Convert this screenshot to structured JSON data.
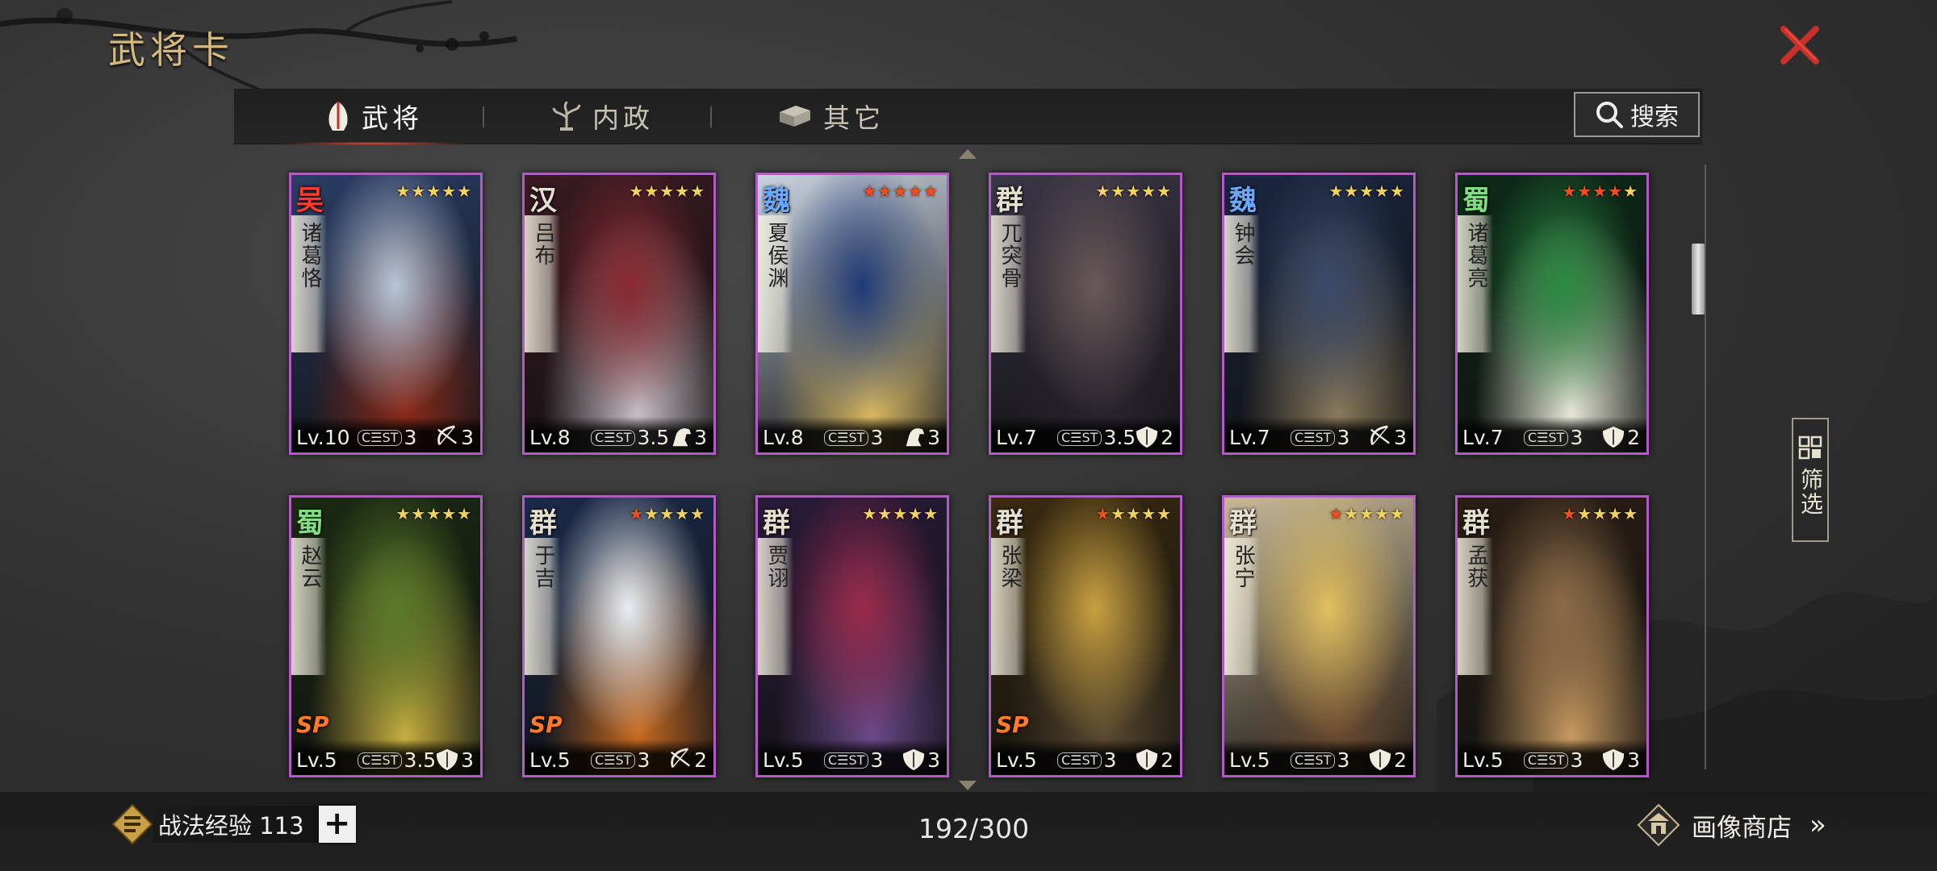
{
  "header": {
    "title": "武将卡"
  },
  "tabs": [
    {
      "label": "武将",
      "icon": "helmet-icon",
      "active": true
    },
    {
      "label": "内政",
      "icon": "tree-icon",
      "active": false
    },
    {
      "label": "其它",
      "icon": "chest-icon",
      "active": false
    }
  ],
  "search": {
    "label": "搜索"
  },
  "filter": {
    "label": "筛选"
  },
  "cards": [
    {
      "faction": "吴",
      "faction_color": "#ff3b2f",
      "name": "诸葛恪",
      "stars_red": 0,
      "level": "Lv.10",
      "cost": "3",
      "troop_icon": "bow-icon",
      "troop_count": "3",
      "sp": false,
      "art": [
        "#2a3d66",
        "#b8c6d8",
        "#8c2a1a"
      ]
    },
    {
      "faction": "汉",
      "faction_color": "#e6e0d0",
      "name": "吕布",
      "stars_red": 0,
      "level": "Lv.8",
      "cost": "3.5",
      "troop_icon": "horse-icon",
      "troop_count": "3",
      "sp": false,
      "art": [
        "#3a1a22",
        "#8a2a30",
        "#c8c0c8"
      ]
    },
    {
      "faction": "魏",
      "faction_color": "#6aa8ff",
      "name": "夏侯渊",
      "stars_red": 5,
      "level": "Lv.8",
      "cost": "3",
      "troop_icon": "horse-icon",
      "troop_count": "3",
      "sp": false,
      "art": [
        "#c8d2e0",
        "#1e3a78",
        "#d8b860"
      ]
    },
    {
      "faction": "群",
      "faction_color": "#e6e0d0",
      "name": "兀突骨",
      "stars_red": 0,
      "level": "Lv.7",
      "cost": "3.5",
      "troop_icon": "shield-icon",
      "troop_count": "2",
      "sp": false,
      "art": [
        "#3c3648",
        "#6a5a5a",
        "#2a2430"
      ]
    },
    {
      "faction": "魏",
      "faction_color": "#6aa8ff",
      "name": "钟会",
      "stars_red": 0,
      "level": "Lv.7",
      "cost": "3",
      "troop_icon": "bow-icon",
      "troop_count": "3",
      "sp": false,
      "art": [
        "#1a2640",
        "#3a4a6a",
        "#8a7a5a"
      ]
    },
    {
      "faction": "蜀",
      "faction_color": "#7ee07e",
      "name": "诸葛亮",
      "stars_red": 4,
      "level": "Lv.7",
      "cost": "3",
      "troop_icon": "shield-icon",
      "troop_count": "2",
      "sp": false,
      "art": [
        "#0c2a18",
        "#2a8a40",
        "#e8e8d8"
      ]
    },
    {
      "faction": "蜀",
      "faction_color": "#7ee07e",
      "name": "赵云",
      "stars_red": 0,
      "level": "Lv.5",
      "cost": "3.5",
      "troop_icon": "shield-icon",
      "troop_count": "3",
      "sp": true,
      "art": [
        "#1a2a12",
        "#5a7a2a",
        "#c8b040"
      ]
    },
    {
      "faction": "群",
      "faction_color": "#e6e0d0",
      "name": "于吉",
      "stars_red": 1,
      "level": "Lv.5",
      "cost": "3",
      "troop_icon": "bow-icon",
      "troop_count": "2",
      "sp": true,
      "art": [
        "#1a2a4a",
        "#e8eef4",
        "#c86a20"
      ]
    },
    {
      "faction": "群",
      "faction_color": "#e6e0d0",
      "name": "贾诩",
      "stars_red": 0,
      "level": "Lv.5",
      "cost": "3",
      "troop_icon": "shield-icon",
      "troop_count": "3",
      "sp": false,
      "art": [
        "#2a1a3a",
        "#9a2a4a",
        "#6a4a8a"
      ]
    },
    {
      "faction": "群",
      "faction_color": "#e6e0d0",
      "name": "张梁",
      "stars_red": 1,
      "level": "Lv.5",
      "cost": "3",
      "troop_icon": "shield-icon",
      "troop_count": "2",
      "sp": true,
      "art": [
        "#3a2a10",
        "#c8a040",
        "#5a4a30"
      ]
    },
    {
      "faction": "群",
      "faction_color": "#e6e0d0",
      "name": "张宁",
      "stars_red": 1,
      "level": "Lv.5",
      "cost": "3",
      "troop_icon": "shield-icon",
      "troop_count": "2",
      "sp": false,
      "art": [
        "#c8b898",
        "#e0c060",
        "#6a4a30"
      ]
    },
    {
      "faction": "群",
      "faction_color": "#e6e0d0",
      "name": "孟获",
      "stars_red": 1,
      "level": "Lv.5",
      "cost": "3",
      "troop_icon": "shield-icon",
      "troop_count": "3",
      "sp": false,
      "art": [
        "#2a1e14",
        "#8a6a48",
        "#c89a60"
      ]
    }
  ],
  "footer": {
    "exp_label": "战法经验 113",
    "count": "192/300",
    "shop_label": "画像商店",
    "shop_arrow": "»"
  }
}
